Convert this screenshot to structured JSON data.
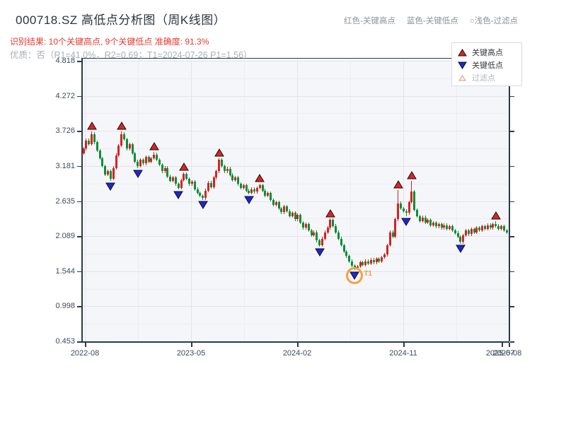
{
  "header": {
    "title": "000718.SZ 高低点分析图（周K线图）",
    "result_line": "识别结果: 10个关键高点, 9个关键低点  准确度: 91.3%",
    "quality_line": "优质：否（R1=41.0%，R2=0.69；T1=2024-07-26 P1=1.56）",
    "color_note": {
      "high": "红色-关键高点",
      "low": "蓝色-关键低点",
      "filtered": "○浅色-过滤点"
    }
  },
  "legend": {
    "items": [
      {
        "label": "关键高点",
        "marker": "up-triangle"
      },
      {
        "label": "关键低点",
        "marker": "down-triangle"
      },
      {
        "label": "过滤点",
        "marker": "pale-triangle"
      }
    ]
  },
  "colors": {
    "candle_up": "#d92121",
    "candle_down": "#0a8f35",
    "key_high_marker": "#e02222",
    "key_low_marker": "#1f24d9",
    "marker_outline": "#111111",
    "filtered_ring": "#f2a33c",
    "filtered_fill": "#ffeee8",
    "filtered_stroke": "#dd9988",
    "subtitle_red": "#e23a30"
  },
  "chart_data": {
    "type": "candlestick",
    "title": "000718.SZ 高低点分析图（周K线图）",
    "frequency": "weekly",
    "key_high_count": 10,
    "key_low_count": 9,
    "accuracy": "91.3%",
    "x_tick_labels": [
      "2022-08",
      "2023-05",
      "2024-02",
      "2024-11",
      "2025-07",
      "2025-08"
    ],
    "y_tick_labels": [
      "4.818",
      "4.272",
      "3.726",
      "3.181",
      "2.635",
      "2.089",
      "1.544",
      "0.998",
      "0.453"
    ],
    "y_tick_values": [
      4.818,
      4.272,
      3.726,
      3.181,
      2.635,
      2.089,
      1.544,
      0.998,
      0.453
    ],
    "ylim": [
      0.453,
      4.818
    ],
    "first_open": 3.38,
    "closes": [
      3.45,
      3.58,
      3.52,
      3.68,
      3.55,
      3.42,
      3.3,
      3.18,
      3.05,
      3.1,
      2.98,
      3.15,
      3.35,
      3.5,
      3.68,
      3.6,
      3.45,
      3.52,
      3.38,
      3.25,
      3.18,
      3.28,
      3.22,
      3.32,
      3.25,
      3.3,
      3.36,
      3.28,
      3.2,
      3.1,
      3.15,
      3.02,
      2.95,
      3.0,
      2.9,
      2.84,
      2.96,
      3.06,
      2.98,
      2.9,
      2.94,
      2.82,
      2.76,
      2.72,
      2.68,
      2.8,
      2.92,
      2.85,
      3.0,
      3.1,
      3.28,
      3.18,
      3.1,
      3.14,
      3.04,
      2.96,
      3.0,
      2.9,
      2.84,
      2.88,
      2.8,
      2.76,
      2.82,
      2.78,
      2.84,
      2.88,
      2.8,
      2.72,
      2.76,
      2.65,
      2.58,
      2.62,
      2.52,
      2.46,
      2.55,
      2.48,
      2.4,
      2.45,
      2.35,
      2.42,
      2.3,
      2.22,
      2.28,
      2.18,
      2.1,
      2.15,
      2.02,
      1.95,
      2.05,
      2.15,
      2.22,
      2.34,
      2.25,
      2.15,
      2.05,
      1.95,
      1.85,
      1.78,
      1.7,
      1.63,
      1.6,
      1.62,
      1.68,
      1.64,
      1.7,
      1.66,
      1.72,
      1.68,
      1.74,
      1.7,
      1.76,
      1.8,
      1.95,
      2.15,
      2.08,
      2.35,
      2.6,
      2.52,
      2.48,
      2.45,
      2.62,
      2.78,
      2.5,
      2.4,
      2.32,
      2.38,
      2.3,
      2.34,
      2.26,
      2.3,
      2.24,
      2.28,
      2.22,
      2.26,
      2.2,
      2.24,
      2.18,
      2.14,
      2.08,
      2.0,
      2.1,
      2.18,
      2.12,
      2.2,
      2.15,
      2.22,
      2.18,
      2.24,
      2.2,
      2.26,
      2.22,
      2.28,
      2.25,
      2.2,
      2.24,
      2.18,
      2.15
    ],
    "key_highs": [
      {
        "week": 3,
        "price": 3.72
      },
      {
        "week": 14,
        "price": 3.72
      },
      {
        "week": 26,
        "price": 3.4
      },
      {
        "week": 37,
        "price": 3.08
      },
      {
        "week": 50,
        "price": 3.3
      },
      {
        "week": 65,
        "price": 2.9
      },
      {
        "week": 91,
        "price": 2.36
      },
      {
        "week": 116,
        "price": 2.81
      },
      {
        "week": 121,
        "price": 2.95
      },
      {
        "week": 152,
        "price": 2.32
      }
    ],
    "key_lows": [
      {
        "week": 10,
        "price": 2.95
      },
      {
        "week": 20,
        "price": 3.15
      },
      {
        "week": 35,
        "price": 2.82
      },
      {
        "week": 44,
        "price": 2.66
      },
      {
        "week": 61,
        "price": 2.74
      },
      {
        "week": 87,
        "price": 1.93
      },
      {
        "week": 100,
        "price": 1.56
      },
      {
        "week": 119,
        "price": 2.4
      },
      {
        "week": 139,
        "price": 1.98
      }
    ],
    "t1_annotation": {
      "week": 100,
      "label": "T1",
      "date": "2024-07-26",
      "price": 1.56
    },
    "grid": true,
    "legend_position": "top-right"
  }
}
